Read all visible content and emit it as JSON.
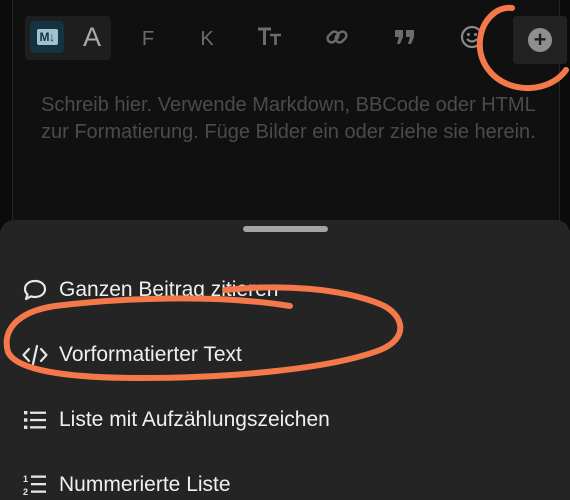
{
  "editor": {
    "placeholder": "Schreib hier. Verwende Markdown, BBCode oder HTML zur Formatierung. Füge Bilder ein oder ziehe sie herein.",
    "toolbar": {
      "markdown_badge": "M↓",
      "rich_text_glyph": "A",
      "bold_label": "F",
      "italic_label": "K",
      "heading_label": "Tт",
      "link_icon": "link-icon",
      "quote_icon": "quote-icon",
      "emoji_icon": "emoji-icon",
      "more_icon": "plus-circle-icon",
      "more_symbol": "+"
    }
  },
  "sheet": {
    "items": [
      {
        "label": "Ganzen Beitrag zitieren",
        "icon": "speech-bubble-icon"
      },
      {
        "label": "Vorformatierter Text",
        "icon": "code-icon"
      },
      {
        "label": "Liste mit Aufzählungszeichen",
        "icon": "bullet-list-icon"
      },
      {
        "label": "Nummerierte Liste",
        "icon": "numbered-list-icon"
      }
    ]
  },
  "colors": {
    "background": "#0b0b0b",
    "sheet": "#242424",
    "annotation": "#f4784a",
    "text": "#f0f0f0",
    "placeholder": "#4b4b4b"
  }
}
